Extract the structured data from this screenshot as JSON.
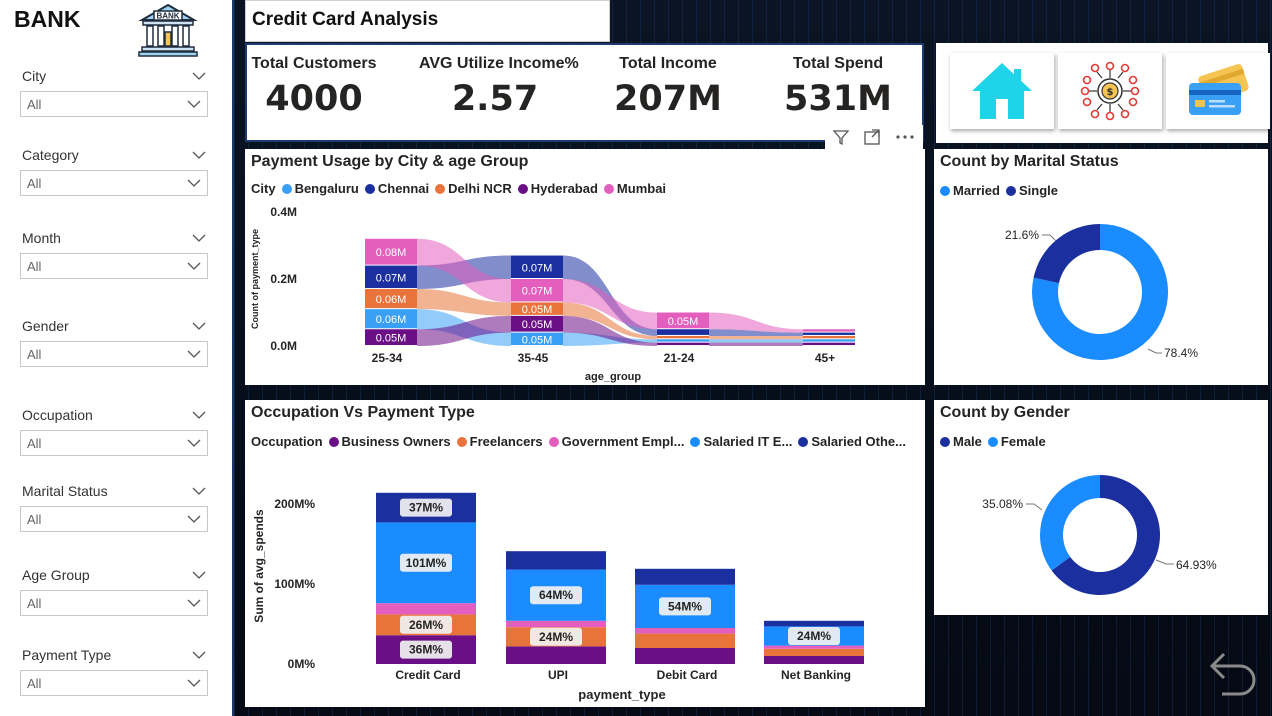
{
  "sidebar": {
    "brand": "BANK",
    "logo_text": "BANK",
    "slicers": [
      {
        "label": "City",
        "value": "All"
      },
      {
        "label": "Category",
        "value": "All"
      },
      {
        "label": "Month",
        "value": "All"
      },
      {
        "label": "Gender",
        "value": "All"
      },
      {
        "label": "Occupation",
        "value": "All"
      },
      {
        "label": "Marital Status",
        "value": "All"
      },
      {
        "label": "Age Group",
        "value": "All"
      },
      {
        "label": "Payment Type",
        "value": "All"
      }
    ]
  },
  "header": {
    "title": "Credit Card Analysis"
  },
  "kpis": [
    {
      "label": "Total Customers",
      "value": "4000"
    },
    {
      "label": "AVG Utilize Income%",
      "value": "2.57"
    },
    {
      "label": "Total Income",
      "value": "207M"
    },
    {
      "label": "Total Spend",
      "value": "531M"
    }
  ],
  "nav_icons": [
    "home-icon",
    "finance-network-icon",
    "credit-cards-icon"
  ],
  "colors": {
    "bengaluru": "#3aa0f5",
    "chennai": "#1b2fa0",
    "delhi": "#e8743b",
    "hyderabad": "#6b0f86",
    "mumbai": "#e45fbd",
    "business_owners": "#6b0f86",
    "freelancers": "#e8743b",
    "government": "#e45fbd",
    "salaried_it": "#1a8cff",
    "salaried_other": "#1b2f9e",
    "married": "#1a8cff",
    "single": "#1b2f9e",
    "male": "#1b2f9e",
    "female": "#1a8cff"
  },
  "ribbon": {
    "title": "Payment Usage by City & age Group",
    "legend_title": "City",
    "legend": [
      "Bengaluru",
      "Chennai",
      "Delhi NCR",
      "Hyderabad",
      "Mumbai"
    ],
    "y_label": "Count of payment_type",
    "x_label": "age_group",
    "y_ticks": [
      "0.4M",
      "0.2M",
      "0.0M"
    ]
  },
  "occupation": {
    "title": "Occupation Vs Payment Type",
    "legend_title": "Occupation",
    "legend": [
      "Business Owners",
      "Freelancers",
      "Government Empl...",
      "Salaried IT E...",
      "Salaried Othe..."
    ],
    "y_label": "Sum of avg_spends",
    "x_label": "payment_type",
    "y_ticks": [
      "200M%",
      "100M%",
      "0M%"
    ]
  },
  "marital": {
    "title": "Count by Marital Status",
    "legend": [
      "Married",
      "Single"
    ]
  },
  "gender": {
    "title": "Count by Gender",
    "legend": [
      "Male",
      "Female"
    ]
  },
  "chart_data": [
    {
      "type": "area",
      "title": "Payment Usage by City & age Group",
      "xlabel": "age_group",
      "ylabel": "Count of payment_type",
      "categories": [
        "25-34",
        "35-45",
        "21-24",
        "45+"
      ],
      "ylim": [
        0,
        0.4
      ],
      "y_unit": "M",
      "series": [
        {
          "name": "Bengaluru",
          "values": [
            0.06,
            0.04,
            0.01,
            0.01
          ]
        },
        {
          "name": "Chennai",
          "values": [
            0.07,
            0.07,
            0.02,
            0.01
          ]
        },
        {
          "name": "Delhi NCR",
          "values": [
            0.06,
            0.04,
            0.01,
            0.01
          ]
        },
        {
          "name": "Hyderabad",
          "values": [
            0.05,
            0.05,
            0.01,
            0.01
          ]
        },
        {
          "name": "Mumbai",
          "values": [
            0.08,
            0.07,
            0.05,
            0.01
          ]
        }
      ],
      "data_labels": {
        "25-34": {
          "Mumbai": "0.08M",
          "Chennai": "0.07M",
          "Delhi NCR": "0.06M",
          "Bengaluru": "0.06M",
          "Hyderabad": "0.05M"
        },
        "35-45": {
          "Chennai": "0.07M",
          "Mumbai": "0.07M",
          "Delhi NCR": "0.05M",
          "Hyderabad": "0.05M",
          "Bengaluru": "0.05M"
        },
        "21-24": {
          "Mumbai": "0.05M"
        }
      }
    },
    {
      "type": "bar",
      "title": "Occupation Vs Payment Type",
      "xlabel": "payment_type",
      "ylabel": "Sum of avg_spends",
      "categories": [
        "Credit Card",
        "UPI",
        "Debit Card",
        "Net Banking"
      ],
      "ylim": [
        0,
        200
      ],
      "y_unit": "M%",
      "series": [
        {
          "name": "Business Owners",
          "values": [
            36,
            22,
            20,
            10
          ]
        },
        {
          "name": "Freelancers",
          "values": [
            26,
            24,
            18,
            9
          ]
        },
        {
          "name": "Government Empl...",
          "values": [
            14,
            8,
            7,
            4
          ]
        },
        {
          "name": "Salaried IT E...",
          "values": [
            101,
            64,
            54,
            24
          ]
        },
        {
          "name": "Salaried Othe...",
          "values": [
            37,
            23,
            20,
            7
          ]
        }
      ],
      "data_labels": {
        "Credit Card": {
          "Business Owners": "36M%",
          "Freelancers": "26M%",
          "Salaried IT E...": "101M%",
          "Salaried Othe...": "37M%"
        },
        "UPI": {
          "Freelancers": "24M%",
          "Salaried IT E...": "64M%"
        },
        "Debit Card": {
          "Salaried IT E...": "54M%"
        },
        "Net Banking": {
          "Salaried IT E...": "24M%"
        }
      }
    },
    {
      "type": "pie",
      "title": "Count by Marital Status",
      "categories": [
        "Married",
        "Single"
      ],
      "values": [
        78.4,
        21.6
      ],
      "labels": [
        "78.4%",
        "21.6%"
      ]
    },
    {
      "type": "pie",
      "title": "Count by Gender",
      "categories": [
        "Male",
        "Female"
      ],
      "values": [
        64.93,
        35.08
      ],
      "labels": [
        "64.93%",
        "35.08%"
      ]
    }
  ]
}
